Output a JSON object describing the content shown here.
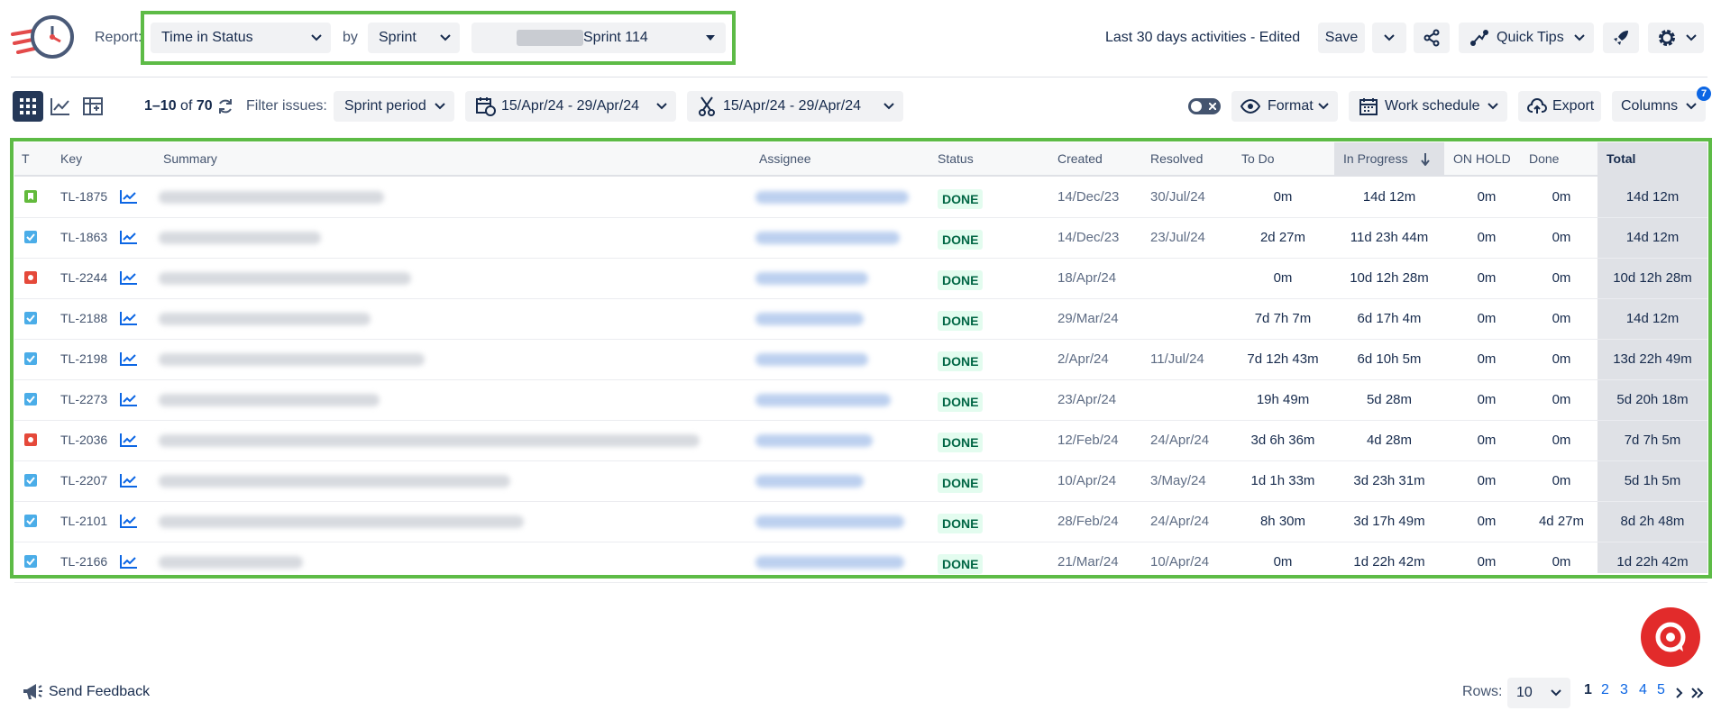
{
  "header": {
    "report_label": "Report:",
    "report_value": "Time in Status",
    "by_label": "by",
    "by_value": "Sprint",
    "sprint_value": "Sprint 114",
    "activity_text": "Last 30 days activities - Edited",
    "save_label": "Save",
    "quick_tips_label": "Quick Tips"
  },
  "toolbar": {
    "range_text": "1–10",
    "of_text": "of",
    "total_count": "70",
    "filter_label": "Filter issues:",
    "filter_value": "Sprint period",
    "date_range_1": "15/Apr/24 - 29/Apr/24",
    "date_range_2": "15/Apr/24 - 29/Apr/24",
    "format_label": "Format",
    "work_schedule_label": "Work schedule",
    "export_label": "Export",
    "columns_label": "Columns",
    "columns_badge": "7"
  },
  "table": {
    "headers": [
      "T",
      "Key",
      "Summary",
      "Assignee",
      "Status",
      "Created",
      "Resolved",
      "To Do",
      "In Progress",
      "ON HOLD",
      "Done",
      "Total"
    ],
    "sort_column": "In Progress",
    "rows": [
      {
        "type": "story",
        "key": "TL-1875",
        "status": "DONE",
        "created": "14/Dec/23",
        "resolved": "30/Jul/24",
        "todo": "0m",
        "inprogress": "14d 12m",
        "onhold": "0m",
        "done": "0m",
        "total": "14d 12m"
      },
      {
        "type": "task",
        "key": "TL-1863",
        "status": "DONE",
        "created": "14/Dec/23",
        "resolved": "23/Jul/24",
        "todo": "2d 27m",
        "inprogress": "11d 23h 44m",
        "onhold": "0m",
        "done": "0m",
        "total": "14d 12m"
      },
      {
        "type": "bug",
        "key": "TL-2244",
        "status": "DONE",
        "created": "18/Apr/24",
        "resolved": "",
        "todo": "0m",
        "inprogress": "10d 12h 28m",
        "onhold": "0m",
        "done": "0m",
        "total": "10d 12h 28m"
      },
      {
        "type": "task",
        "key": "TL-2188",
        "status": "DONE",
        "created": "29/Mar/24",
        "resolved": "",
        "todo": "7d 7h 7m",
        "inprogress": "6d 17h 4m",
        "onhold": "0m",
        "done": "0m",
        "total": "14d 12m"
      },
      {
        "type": "task",
        "key": "TL-2198",
        "status": "DONE",
        "created": "2/Apr/24",
        "resolved": "11/Jul/24",
        "todo": "7d 12h 43m",
        "inprogress": "6d 10h 5m",
        "onhold": "0m",
        "done": "0m",
        "total": "13d 22h 49m"
      },
      {
        "type": "task",
        "key": "TL-2273",
        "status": "DONE",
        "created": "23/Apr/24",
        "resolved": "",
        "todo": "19h 49m",
        "inprogress": "5d 28m",
        "onhold": "0m",
        "done": "0m",
        "total": "5d 20h 18m"
      },
      {
        "type": "bug",
        "key": "TL-2036",
        "status": "DONE",
        "created": "12/Feb/24",
        "resolved": "24/Apr/24",
        "todo": "3d 6h 36m",
        "inprogress": "4d 28m",
        "onhold": "0m",
        "done": "0m",
        "total": "7d 7h 5m"
      },
      {
        "type": "task",
        "key": "TL-2207",
        "status": "DONE",
        "created": "10/Apr/24",
        "resolved": "3/May/24",
        "todo": "1d 1h 33m",
        "inprogress": "3d 23h 31m",
        "onhold": "0m",
        "done": "0m",
        "total": "5d 1h 5m"
      },
      {
        "type": "task",
        "key": "TL-2101",
        "status": "DONE",
        "created": "28/Feb/24",
        "resolved": "24/Apr/24",
        "todo": "8h 30m",
        "inprogress": "3d 17h 49m",
        "onhold": "0m",
        "done": "4d 27m",
        "total": "8d 2h 48m"
      },
      {
        "type": "task",
        "key": "TL-2166",
        "status": "DONE",
        "created": "21/Mar/24",
        "resolved": "10/Apr/24",
        "todo": "0m",
        "inprogress": "1d 22h 42m",
        "onhold": "0m",
        "done": "0m",
        "total": "1d 22h 42m"
      }
    ]
  },
  "footer": {
    "feedback_label": "Send Feedback",
    "rows_label": "Rows:",
    "rows_value": "10",
    "pages": [
      "1",
      "2",
      "3",
      "4",
      "5"
    ]
  },
  "colors": {
    "highlight": "#5dbb46",
    "done_badge_bg": "#e3fcef",
    "done_badge_text": "#006644",
    "link": "#0c66e4",
    "help_button": "#e22b2b"
  }
}
